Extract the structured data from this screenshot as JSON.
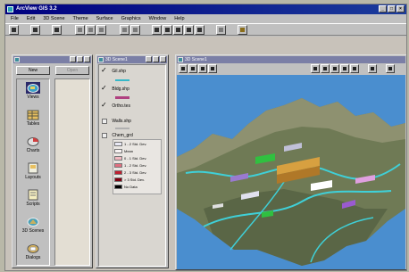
{
  "app": {
    "title": "ArcView GIS 3.2",
    "window_buttons": {
      "minimize": "_",
      "maximize": "□",
      "close": "×"
    }
  },
  "menu": [
    "File",
    "Edit",
    "3D Scene",
    "Theme",
    "Surface",
    "Graphics",
    "Window",
    "Help"
  ],
  "toolbar_icons": [
    "save-project-icon",
    "add-theme-icon",
    "properties-icon",
    "theme-on-icon",
    "theme-off-icon",
    "table-icon",
    "zoom-extent-icon",
    "zoom-themes-icon",
    "zoom-selected-icon",
    "navigate-icon",
    "zoom-in-icon",
    "zoom-out-icon",
    "zoom-full-icon",
    "layout-icon",
    "help-icon"
  ],
  "project_window": {
    "title": "",
    "new_label": "New",
    "open_label": "Open",
    "items": [
      {
        "label": "Views",
        "icon": "views-icon",
        "selected": true
      },
      {
        "label": "Tables",
        "icon": "tables-icon",
        "selected": false
      },
      {
        "label": "Charts",
        "icon": "charts-icon",
        "selected": false
      },
      {
        "label": "Layouts",
        "icon": "layouts-icon",
        "selected": false
      },
      {
        "label": "Scripts",
        "icon": "scripts-icon",
        "selected": false
      },
      {
        "label": "3D Scenes",
        "icon": "3d-scenes-icon",
        "selected": false
      },
      {
        "label": "Dialogs",
        "icon": "dialogs-icon",
        "selected": false
      }
    ]
  },
  "legend_window": {
    "title": "3D Scene1",
    "themes": [
      {
        "name": "Gil.shp",
        "checked": true,
        "line_color": "#36b8c8"
      },
      {
        "name": "Bldg.shp",
        "checked": true,
        "line_color": "#b04080"
      },
      {
        "name": "Ortho.tes",
        "checked": true,
        "line_color": "#808080"
      },
      {
        "name": "Walls.shp",
        "checked": false,
        "line_color": "#b0b0b0"
      }
    ],
    "grid_theme": {
      "name": "Chem_grd",
      "classes": [
        {
          "label": "1 - 2 Std. Dev.",
          "color": "#e8e8f4"
        },
        {
          "label": "Mean",
          "color": "#f7f2f2"
        },
        {
          "label": "0 - 1 Std. Dev.",
          "color": "#f2b8c0"
        },
        {
          "label": "1 - 2 Std. Dev.",
          "color": "#e07080"
        },
        {
          "label": "2 - 3 Std. Dev.",
          "color": "#c02030"
        },
        {
          "label": "> 3 Std. Dev.",
          "color": "#800010"
        },
        {
          "label": "No Data",
          "color": "#000000"
        }
      ]
    }
  },
  "scene_window": {
    "title": "3D Scene1",
    "tool_icons": [
      "navigate-tool-icon",
      "zoom-in-tool-icon",
      "zoom-out-tool-icon",
      "pan-tool-icon",
      "full-extent-icon",
      "zoom-to-themes-icon",
      "zoom-to-selected-icon",
      "identify-icon",
      "pointer-icon",
      "minimize-pane-icon"
    ],
    "colors": {
      "sky": "#4a8ecf",
      "terrain": "#6f7a55",
      "roads": "#3fd0d8"
    }
  }
}
